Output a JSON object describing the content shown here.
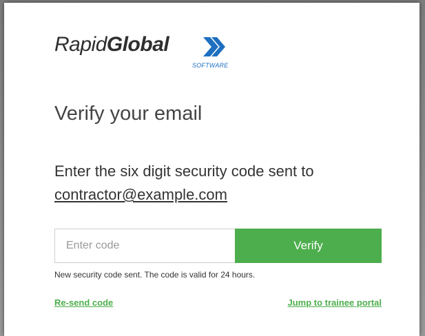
{
  "logo": {
    "word_part1": "Rapid",
    "word_part2": "Global",
    "subtitle": "SOFTWARE",
    "icon": "double-chevron-right-icon",
    "chevron_color": "#1e6fc0"
  },
  "page": {
    "title": "Verify your email",
    "instruction": "Enter the six digit security code sent to",
    "email": "contractor@example.com"
  },
  "form": {
    "code_placeholder": "Enter code",
    "code_value": "",
    "verify_label": "Verify",
    "status_message": "New security code sent. The code is valid for 24 hours."
  },
  "links": {
    "resend": "Re-send code",
    "portal": "Jump to trainee portal"
  },
  "colors": {
    "accent_green": "#4cae4c",
    "text_dark": "#333333"
  }
}
